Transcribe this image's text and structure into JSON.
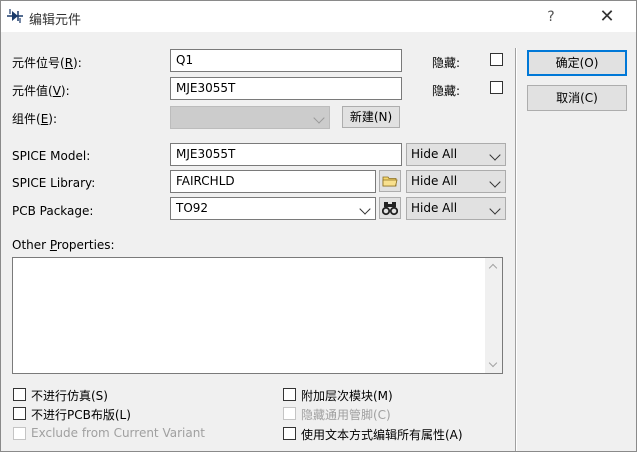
{
  "window": {
    "title": "编辑元件",
    "help_label": "?",
    "close_label": "✕"
  },
  "fields": {
    "designator": {
      "label_pre": "元件位号(",
      "accel": "R",
      "label_post": "):",
      "value": "Q1",
      "hidden_label": "隐藏:"
    },
    "value": {
      "label_pre": "元件值(",
      "accel": "V",
      "label_post": "):",
      "value": "MJE3055T",
      "hidden_label": "隐藏:"
    },
    "part": {
      "label_pre": "组件(",
      "accel": "E",
      "label_post": "):",
      "value": "",
      "new_button": "新建(N)"
    },
    "spice_model": {
      "label": "SPICE Model:",
      "value": "MJE3055T",
      "visibility": "Hide All"
    },
    "spice_library": {
      "label": "SPICE Library:",
      "value": "FAIRCHLD",
      "visibility": "Hide All"
    },
    "pcb_package": {
      "label": "PCB Package:",
      "value": "TO92",
      "visibility": "Hide All"
    }
  },
  "other_properties": {
    "label_pre": "Other ",
    "accel": "P",
    "label_post": "roperties:",
    "value": ""
  },
  "checkboxes": {
    "exclude_sim": {
      "label": "不进行仿真(S)",
      "checked": false,
      "enabled": true
    },
    "exclude_pcb": {
      "label": "不进行PCB布版(L)",
      "checked": false,
      "enabled": true
    },
    "exclude_variant": {
      "label": "Exclude from Current Variant",
      "checked": false,
      "enabled": false
    },
    "attach_hier": {
      "label": "附加层次模块(M)",
      "checked": false,
      "enabled": true
    },
    "hide_pins": {
      "label": "隐藏通用管脚(C)",
      "checked": false,
      "enabled": false
    },
    "edit_text": {
      "label": "使用文本方式编辑所有属性(A)",
      "checked": false,
      "enabled": true
    }
  },
  "buttons": {
    "ok": "确定(O)",
    "cancel": "取消(C)"
  },
  "icons": {
    "app": "component-icon",
    "browse": "folder-icon",
    "find": "binoculars-icon"
  },
  "colors": {
    "accent": "#0078d7",
    "window_bg": "#f0f0f0",
    "disabled_text": "#a0a0a0"
  }
}
